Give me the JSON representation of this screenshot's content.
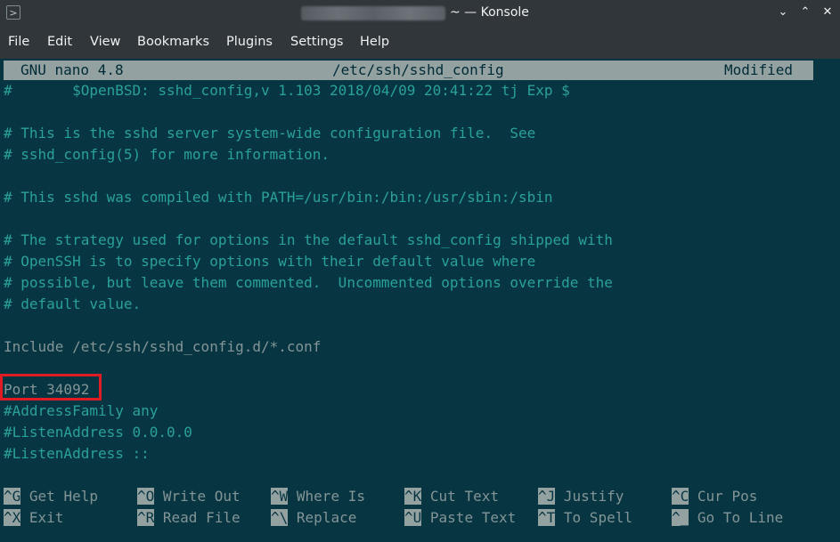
{
  "window": {
    "title": "~ — Konsole",
    "app_icon": ">",
    "minimize_icon": "⌄",
    "maximize_icon": "⌃",
    "close_icon": "✕"
  },
  "menu": [
    "File",
    "Edit",
    "View",
    "Bookmarks",
    "Plugins",
    "Settings",
    "Help"
  ],
  "nano": {
    "version": "GNU nano 4.8",
    "filename": "/etc/ssh/sshd_config",
    "status": "Modified"
  },
  "lines": [
    "#       $OpenBSD: sshd_config,v 1.103 2018/04/09 20:41:22 tj Exp $",
    "",
    "# This is the sshd server system-wide configuration file.  See",
    "# sshd_config(5) for more information.",
    "",
    "# This sshd was compiled with PATH=/usr/bin:/bin:/usr/sbin:/sbin",
    "",
    "# The strategy used for options in the default sshd_config shipped with",
    "# OpenSSH is to specify options with their default value where",
    "# possible, but leave them commented.  Uncommented options override the",
    "# default value.",
    "",
    "Include /etc/ssh/sshd_config.d/*.conf",
    "",
    "Port 34092",
    "#AddressFamily any",
    "#ListenAddress 0.0.0.0",
    "#ListenAddress ::"
  ],
  "shortcuts": [
    {
      "key": "^G",
      "label": "Get Help"
    },
    {
      "key": "^O",
      "label": "Write Out"
    },
    {
      "key": "^W",
      "label": "Where Is"
    },
    {
      "key": "^K",
      "label": "Cut Text"
    },
    {
      "key": "^J",
      "label": "Justify"
    },
    {
      "key": "^C",
      "label": "Cur Pos"
    },
    {
      "key": "^X",
      "label": "Exit"
    },
    {
      "key": "^R",
      "label": "Read File"
    },
    {
      "key": "^\\",
      "label": "Replace"
    },
    {
      "key": "^U",
      "label": "Paste Text"
    },
    {
      "key": "^T",
      "label": "To Spell"
    },
    {
      "key": "^_",
      "label": "Go To Line"
    }
  ],
  "colors": {
    "terminal_bg": "#073642",
    "comment": "#2aa198",
    "text": "#839496",
    "highlight_box": "#e01b24"
  }
}
